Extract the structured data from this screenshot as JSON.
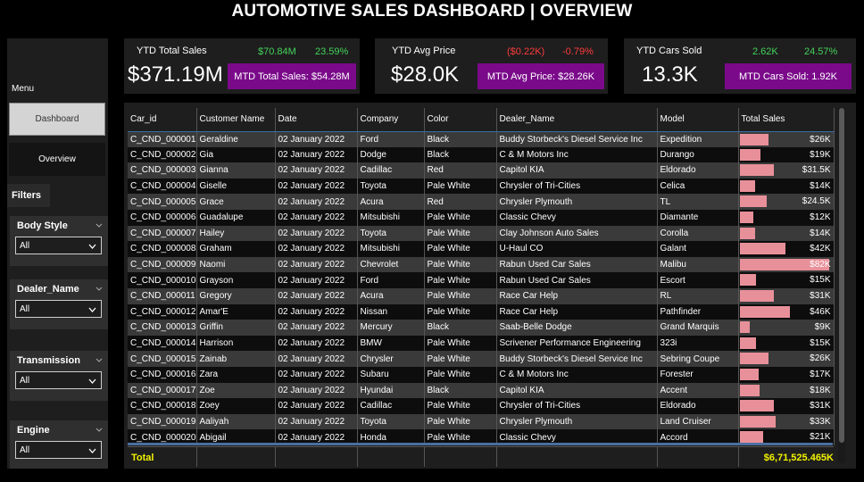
{
  "title": "AUTOMOTIVE SALES DASHBOARD | OVERVIEW",
  "sidebar": {
    "menu_label": "Menu",
    "dashboard_button": "Dashboard",
    "overview_button": "Overview",
    "filters_label": "Filters",
    "slicers": [
      {
        "label": "Body Style",
        "value": "All"
      },
      {
        "label": "Dealer_Name",
        "value": "All"
      },
      {
        "label": "Transmission",
        "value": "All"
      },
      {
        "label": "Engine",
        "value": "All"
      }
    ]
  },
  "kpis": [
    {
      "label": "YTD Total Sales",
      "value": "$371.19M",
      "delta_value": "$70.84M",
      "delta_pct": "23.59%",
      "trend": "up",
      "mtd": "MTD Total Sales: $54.28M"
    },
    {
      "label": "YTD Avg Price",
      "value": "$28.0K",
      "delta_value": "($0.22K)",
      "delta_pct": "-0.79%",
      "trend": "down",
      "mtd": "MTD Avg Price: $28.26K"
    },
    {
      "label": "YTD Cars Sold",
      "value": "13.3K",
      "delta_value": "2.62K",
      "delta_pct": "24.57%",
      "trend": "up",
      "mtd": "MTD Cars Sold: 1.92K"
    }
  ],
  "colors": {
    "accent_purple": "#7a0a8a",
    "positive": "#43d35a",
    "negative": "#ff3b3b",
    "bar": "#e8909a",
    "total": "#f2f200"
  },
  "table": {
    "columns": [
      "Car_id",
      "Customer Name",
      "Date",
      "Company",
      "Color",
      "Dealer_Name",
      "Model",
      "Total Sales"
    ],
    "rows": [
      [
        "C_CND_000001",
        "Geraldine",
        "02 January 2022",
        "Ford",
        "Black",
        "Buddy Storbeck's Diesel Service Inc",
        "Expedition",
        "$26K",
        26
      ],
      [
        "C_CND_000002",
        "Gia",
        "02 January 2022",
        "Dodge",
        "Black",
        "C & M Motors Inc",
        "Durango",
        "$19K",
        19
      ],
      [
        "C_CND_000003",
        "Gianna",
        "02 January 2022",
        "Cadillac",
        "Red",
        "Capitol KIA",
        "Eldorado",
        "$31.5K",
        31.5
      ],
      [
        "C_CND_000004",
        "Giselle",
        "02 January 2022",
        "Toyota",
        "Pale White",
        "Chrysler of Tri-Cities",
        "Celica",
        "$14K",
        14
      ],
      [
        "C_CND_000005",
        "Grace",
        "02 January 2022",
        "Acura",
        "Red",
        "Chrysler Plymouth",
        "TL",
        "$24.5K",
        24.5
      ],
      [
        "C_CND_000006",
        "Guadalupe",
        "02 January 2022",
        "Mitsubishi",
        "Pale White",
        "Classic Chevy",
        "Diamante",
        "$12K",
        12
      ],
      [
        "C_CND_000007",
        "Hailey",
        "02 January 2022",
        "Toyota",
        "Pale White",
        "Clay Johnson Auto Sales",
        "Corolla",
        "$14K",
        14
      ],
      [
        "C_CND_000008",
        "Graham",
        "02 January 2022",
        "Mitsubishi",
        "Pale White",
        "U-Haul CO",
        "Galant",
        "$42K",
        42
      ],
      [
        "C_CND_000009",
        "Naomi",
        "02 January 2022",
        "Chevrolet",
        "Pale White",
        "Rabun Used Car Sales",
        "Malibu",
        "$82K",
        82
      ],
      [
        "C_CND_000010",
        "Grayson",
        "02 January 2022",
        "Ford",
        "Pale White",
        "Rabun Used Car Sales",
        "Escort",
        "$15K",
        15
      ],
      [
        "C_CND_000011",
        "Gregory",
        "02 January 2022",
        "Acura",
        "Pale White",
        "Race Car Help",
        "RL",
        "$31K",
        31
      ],
      [
        "C_CND_000012",
        "Amar'E",
        "02 January 2022",
        "Nissan",
        "Pale White",
        "Race Car Help",
        "Pathfinder",
        "$46K",
        46
      ],
      [
        "C_CND_000013",
        "Griffin",
        "02 January 2022",
        "Mercury",
        "Black",
        "Saab-Belle Dodge",
        "Grand Marquis",
        "$9K",
        9
      ],
      [
        "C_CND_000014",
        "Harrison",
        "02 January 2022",
        "BMW",
        "Pale White",
        "Scrivener Performance Engineering",
        "323i",
        "$15K",
        15
      ],
      [
        "C_CND_000015",
        "Zainab",
        "02 January 2022",
        "Chrysler",
        "Pale White",
        "Buddy Storbeck's Diesel Service Inc",
        "Sebring Coupe",
        "$26K",
        26
      ],
      [
        "C_CND_000016",
        "Zara",
        "02 January 2022",
        "Subaru",
        "Pale White",
        "C & M Motors Inc",
        "Forester",
        "$17K",
        17
      ],
      [
        "C_CND_000017",
        "Zoe",
        "02 January 2022",
        "Hyundai",
        "Black",
        "Capitol KIA",
        "Accent",
        "$18K",
        18
      ],
      [
        "C_CND_000018",
        "Zoey",
        "02 January 2022",
        "Cadillac",
        "Pale White",
        "Chrysler of Tri-Cities",
        "Eldorado",
        "$31K",
        31
      ],
      [
        "C_CND_000019",
        "Aaliyah",
        "02 January 2022",
        "Toyota",
        "Pale White",
        "Chrysler Plymouth",
        "Land Cruiser",
        "$33K",
        33
      ],
      [
        "C_CND_000020",
        "Abigail",
        "02 January 2022",
        "Honda",
        "Pale White",
        "Classic Chevy",
        "Accord",
        "$21K",
        21
      ]
    ],
    "bar_max": 82,
    "total_label": "Total",
    "total_value": "$6,71,525.465K"
  }
}
